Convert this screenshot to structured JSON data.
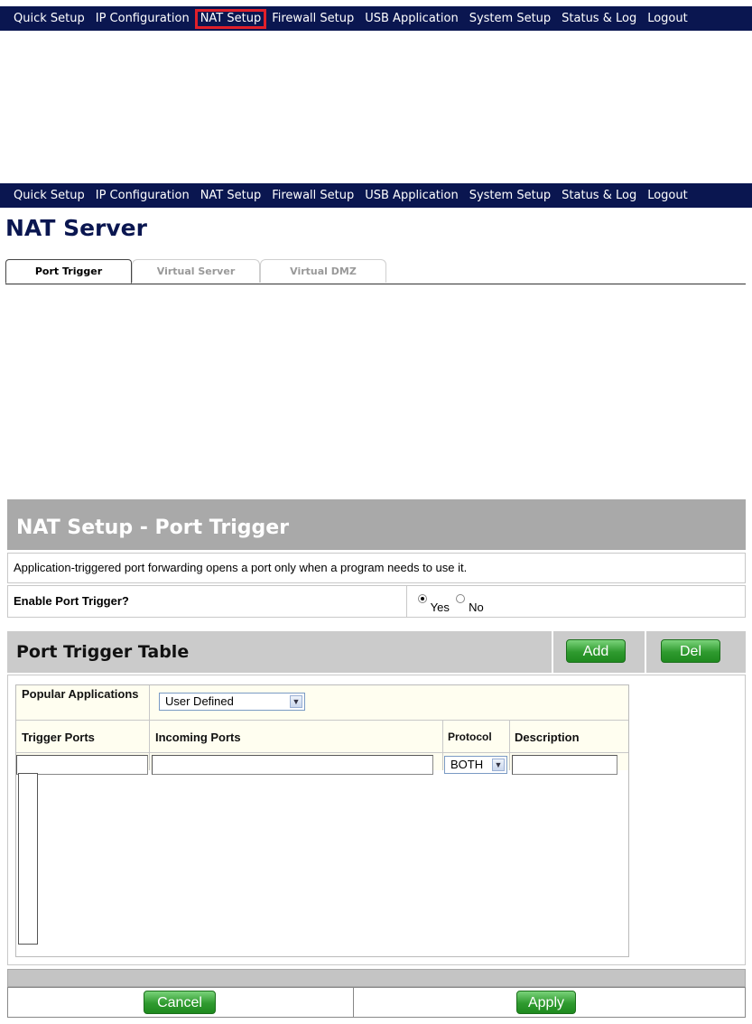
{
  "nav": {
    "items": [
      "Quick Setup",
      "IP Configuration",
      "NAT Setup",
      "Firewall Setup",
      "USB Application",
      "System Setup",
      "Status & Log",
      "Logout"
    ],
    "highlighted": "NAT Setup"
  },
  "page_title": "NAT Server",
  "tabs": [
    "Port Trigger",
    "Virtual Server",
    "Virtual DMZ"
  ],
  "panel": {
    "title": "NAT Setup - Port Trigger",
    "description": "Application-triggered port forwarding opens a port only when a program needs to use it.",
    "enable_label": "Enable Port Trigger?",
    "radio_yes": "Yes",
    "radio_no": "No",
    "radio_selected": "Yes",
    "table_title": "Port Trigger Table",
    "add_label": "Add",
    "del_label": "Del",
    "popular_apps_label": "Popular Applications",
    "popular_apps_value": "User Defined",
    "col_trigger": "Trigger Ports",
    "col_incoming": "Incoming Ports",
    "col_protocol": "Protocol",
    "col_description": "Description",
    "protocol_value": "BOTH",
    "cancel_label": "Cancel",
    "apply_label": "Apply"
  },
  "colors": {
    "nav_bg": "#0a1650",
    "highlight": "#e0202a",
    "header_gray": "#a9a9a9",
    "button_green": "#2f9a2f"
  }
}
